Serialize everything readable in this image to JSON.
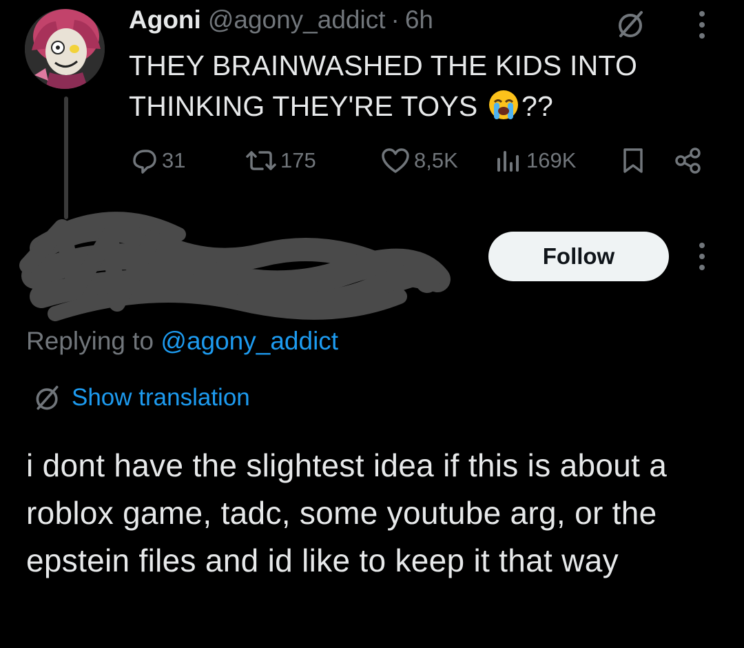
{
  "original_post": {
    "display_name": "Agoni",
    "handle": "@agony_addict",
    "separator": "·",
    "time": "6h",
    "text": "THEY BRAINWASHED THE KIDS INTO THINKING THEY'RE TOYS",
    "text_suffix": "??",
    "emoji_icon": "loudly-crying-face-icon",
    "stats": {
      "replies": "31",
      "reposts": "175",
      "likes": "8,5K",
      "views": "169K"
    },
    "icons": [
      "grok-translate-icon",
      "more-options-icon",
      "reply-icon",
      "repost-icon",
      "like-icon",
      "views-icon",
      "bookmark-icon",
      "share-icon"
    ]
  },
  "reply": {
    "follow_label": "Follow",
    "replying_prefix": "Replying to ",
    "replying_mention": "@agony_addict",
    "show_translation": "Show translation",
    "text": "i dont have the slightest idea if this is about a roblox game, tadc, some youtube arg, or the epstein files and id like to keep it that way",
    "author_redacted": true
  },
  "colors": {
    "background": "#000000",
    "text": "#e7e9ea",
    "muted": "#71767b",
    "link": "#1d9bf0",
    "follow_bg": "#eff3f4",
    "redaction": "#4a4a4a"
  }
}
